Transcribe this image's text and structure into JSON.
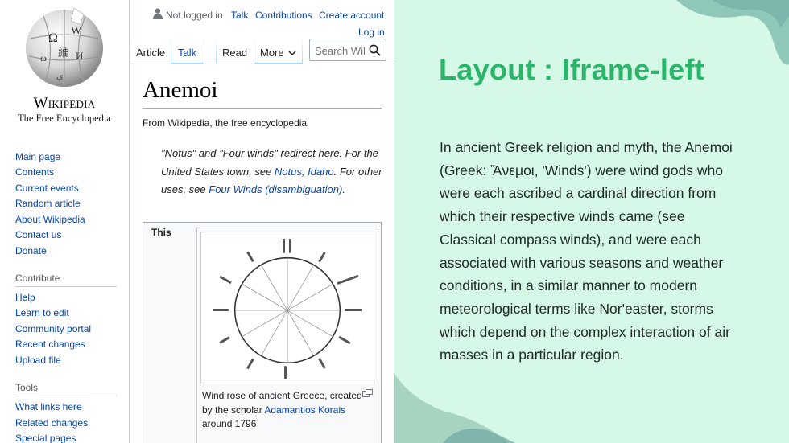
{
  "wiki": {
    "wordmark": "Wikipedia",
    "tagline": "The Free Encyclopedia",
    "personal": {
      "not_logged_in": "Not logged in",
      "talk": "Talk",
      "contributions": "Contributions",
      "create_account": "Create account",
      "log_in": "Log in"
    },
    "tabs": {
      "article": "Article",
      "talk": "Talk",
      "read": "Read",
      "more": "More"
    },
    "search": {
      "placeholder": "Search Wikipedia"
    },
    "nav": {
      "main": [
        "Main page",
        "Contents",
        "Current events",
        "Random article",
        "About Wikipedia",
        "Contact us",
        "Donate"
      ],
      "contribute_heading": "Contribute",
      "contribute": [
        "Help",
        "Learn to edit",
        "Community portal",
        "Recent changes",
        "Upload file"
      ],
      "tools_heading": "Tools",
      "tools": [
        "What links here",
        "Related changes",
        "Special pages"
      ]
    },
    "article": {
      "title": "Anemoi",
      "from": "From Wikipedia, the free encyclopedia",
      "hatnote_1": "\"Notus\" and \"Four winds\" redirect here. For the United States town, see ",
      "hatnote_link_1": "Notus, Idaho",
      "hatnote_2": ". For other uses, see ",
      "hatnote_link_2": "Four Winds (disambiguation)",
      "hatnote_3": ".",
      "infobox_label": "This",
      "caption_1": "Wind rose of ancient Greece, created by the scholar ",
      "caption_link": "Adamantios Korais",
      "caption_2": " around 1796"
    }
  },
  "panel": {
    "title": "Layout : Iframe-left",
    "description": "In ancient Greek religion and myth, the Anemoi (Greek: Ἄνεμοι, 'Winds') were wind gods who were each ascribed a cardinal direction from which their respective winds came (see Classical compass winds), and were each associated with various seasons and weather conditions, in a similar manner to modern meteorological terms like Nor'easter, storms which depend on the complex interaction of air masses in a particular region.",
    "colors": {
      "background": "#d6f8e6",
      "title": "#2bb56a",
      "blob": "#8fc7b8"
    }
  }
}
